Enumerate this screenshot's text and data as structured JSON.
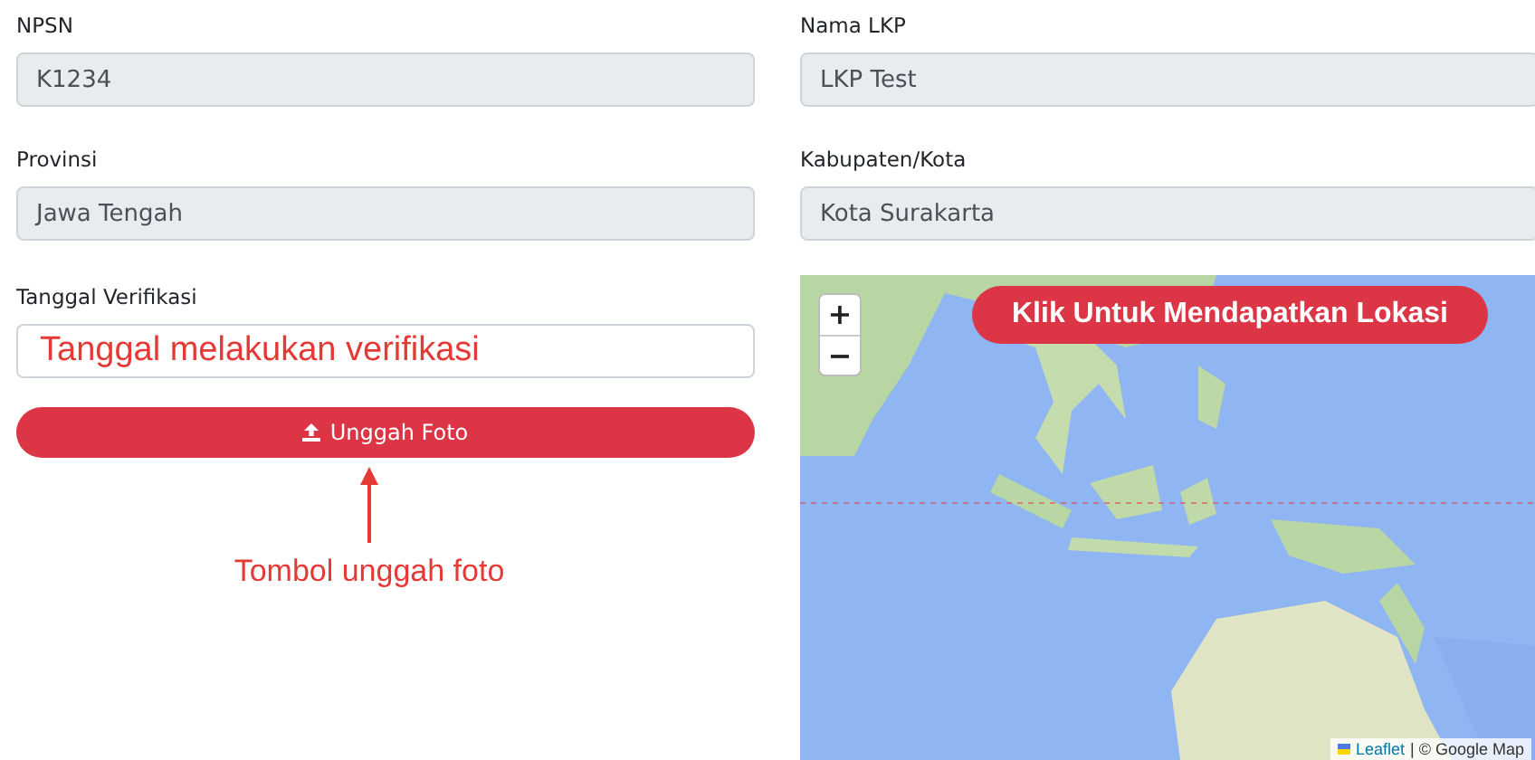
{
  "fields": [
    {
      "label": "NPSN",
      "value": "K1234",
      "disabled": true
    },
    {
      "label": "Nama LKP",
      "value": "LKP Test",
      "disabled": true
    },
    {
      "label": "Provinsi",
      "value": "Jawa Tengah",
      "disabled": true
    },
    {
      "label": "Kabupaten/Kota",
      "value": "Kota Surakarta",
      "disabled": true
    }
  ],
  "verification": {
    "label": "Tanggal Verifikasi",
    "annotation": "Tanggal melakukan verifikasi"
  },
  "upload_button": {
    "label": "Unggah Foto"
  },
  "upload_annotation": "Tombol unggah foto",
  "map": {
    "zoom_in": "+",
    "zoom_out": "−",
    "location_button": "Klik Untuk Mendapatkan Lokasi",
    "attribution_link": "Leaflet",
    "attribution": "| © Google Map"
  }
}
